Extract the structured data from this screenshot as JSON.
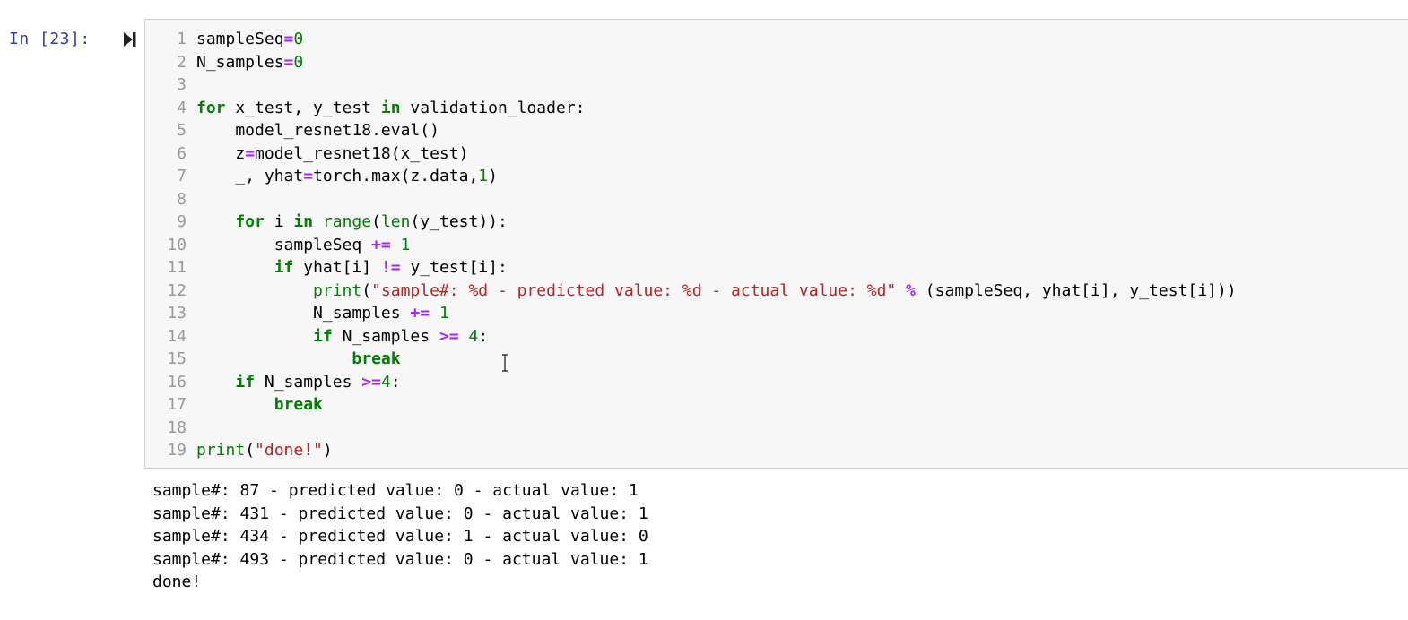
{
  "cell": {
    "prompt": "In [23]:",
    "run_button_icon": "run-step-icon",
    "colors": {
      "prompt": "#303f9f",
      "keyword": "#008000",
      "operator": "#aa22ff",
      "number": "#008000",
      "string": "#ba2121",
      "line_number": "#999999",
      "cell_background": "#f7f7f7",
      "cell_border": "#cfcfcf"
    },
    "lines": [
      {
        "n": "1",
        "tokens": [
          [
            "t",
            "sampleSeq"
          ],
          [
            "op",
            "="
          ],
          [
            "num",
            "0"
          ]
        ]
      },
      {
        "n": "2",
        "tokens": [
          [
            "t",
            "N_samples"
          ],
          [
            "op",
            "="
          ],
          [
            "num",
            "0"
          ]
        ]
      },
      {
        "n": "3",
        "tokens": []
      },
      {
        "n": "4",
        "tokens": [
          [
            "kw",
            "for"
          ],
          [
            "t",
            " x_test, y_test "
          ],
          [
            "kw",
            "in"
          ],
          [
            "t",
            " validation_loader:"
          ]
        ]
      },
      {
        "n": "5",
        "tokens": [
          [
            "t",
            "    model_resnet18.eval()"
          ]
        ]
      },
      {
        "n": "6",
        "tokens": [
          [
            "t",
            "    z"
          ],
          [
            "op",
            "="
          ],
          [
            "t",
            "model_resnet18(x_test)"
          ]
        ]
      },
      {
        "n": "7",
        "tokens": [
          [
            "t",
            "    _, yhat"
          ],
          [
            "op",
            "="
          ],
          [
            "t",
            "torch.max(z.data,"
          ],
          [
            "num",
            "1"
          ],
          [
            "t",
            ")"
          ]
        ]
      },
      {
        "n": "8",
        "tokens": []
      },
      {
        "n": "9",
        "tokens": [
          [
            "t",
            "    "
          ],
          [
            "kw",
            "for"
          ],
          [
            "t",
            " i "
          ],
          [
            "kw",
            "in"
          ],
          [
            "t",
            " "
          ],
          [
            "bi",
            "range"
          ],
          [
            "t",
            "("
          ],
          [
            "bi",
            "len"
          ],
          [
            "t",
            "(y_test)):"
          ]
        ]
      },
      {
        "n": "10",
        "tokens": [
          [
            "t",
            "        sampleSeq "
          ],
          [
            "op",
            "+="
          ],
          [
            "t",
            " "
          ],
          [
            "num",
            "1"
          ]
        ]
      },
      {
        "n": "11",
        "tokens": [
          [
            "t",
            "        "
          ],
          [
            "kw",
            "if"
          ],
          [
            "t",
            " yhat[i] "
          ],
          [
            "op",
            "!="
          ],
          [
            "t",
            " y_test[i]:"
          ]
        ]
      },
      {
        "n": "12",
        "tokens": [
          [
            "t",
            "            "
          ],
          [
            "bi",
            "print"
          ],
          [
            "t",
            "("
          ],
          [
            "str",
            "\"sample#: %d - predicted value: %d - actual value: %d\""
          ],
          [
            "t",
            " "
          ],
          [
            "op",
            "%"
          ],
          [
            "t",
            " (sampleSeq, yhat[i], y_test[i]))"
          ]
        ]
      },
      {
        "n": "13",
        "tokens": [
          [
            "t",
            "            N_samples "
          ],
          [
            "op",
            "+="
          ],
          [
            "t",
            " "
          ],
          [
            "num",
            "1"
          ]
        ]
      },
      {
        "n": "14",
        "tokens": [
          [
            "t",
            "            "
          ],
          [
            "kw",
            "if"
          ],
          [
            "t",
            " N_samples "
          ],
          [
            "op",
            ">="
          ],
          [
            "t",
            " "
          ],
          [
            "num",
            "4"
          ],
          [
            "t",
            ":"
          ]
        ]
      },
      {
        "n": "15",
        "tokens": [
          [
            "t",
            "                "
          ],
          [
            "kw",
            "break"
          ]
        ]
      },
      {
        "n": "16",
        "tokens": [
          [
            "t",
            "    "
          ],
          [
            "kw",
            "if"
          ],
          [
            "t",
            " N_samples "
          ],
          [
            "op",
            ">="
          ],
          [
            "num",
            "4"
          ],
          [
            "t",
            ":"
          ]
        ]
      },
      {
        "n": "17",
        "tokens": [
          [
            "t",
            "        "
          ],
          [
            "kw",
            "break"
          ]
        ]
      },
      {
        "n": "18",
        "tokens": []
      },
      {
        "n": "19",
        "tokens": [
          [
            "bi",
            "print"
          ],
          [
            "t",
            "("
          ],
          [
            "str",
            "\"done!\""
          ],
          [
            "t",
            ")"
          ]
        ]
      }
    ]
  },
  "output": {
    "lines": [
      "sample#: 87 - predicted value: 0 - actual value: 1",
      "sample#: 431 - predicted value: 0 - actual value: 1",
      "sample#: 434 - predicted value: 1 - actual value: 0",
      "sample#: 493 - predicted value: 0 - actual value: 1",
      "done!"
    ]
  }
}
